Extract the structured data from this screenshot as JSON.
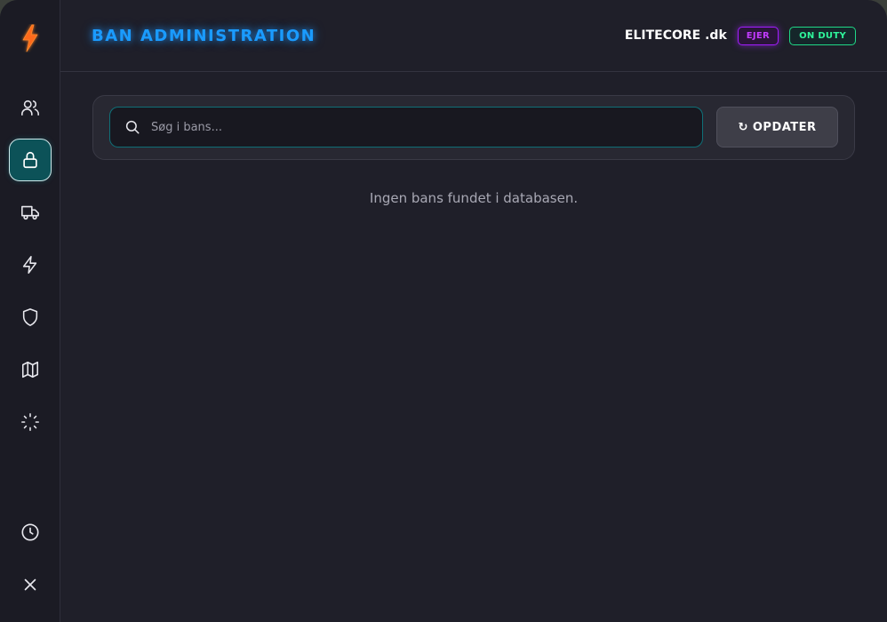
{
  "header": {
    "title": "BAN ADMINISTRATION",
    "server_name": "ELITECORE .dk",
    "badge_role": "EJER",
    "badge_status": "ON DUTY"
  },
  "sidebar": {
    "items": [
      {
        "icon": "users-icon"
      },
      {
        "icon": "lock-icon",
        "active": true
      },
      {
        "icon": "truck-icon"
      },
      {
        "icon": "bolt-icon"
      },
      {
        "icon": "shield-icon"
      },
      {
        "icon": "map-icon"
      },
      {
        "icon": "loader-icon"
      },
      {
        "icon": "clock-icon"
      },
      {
        "icon": "close-icon"
      }
    ]
  },
  "search": {
    "placeholder": "Søg i bans...",
    "value": ""
  },
  "toolbar": {
    "refresh_icon": "↻",
    "refresh_label": "OPDATER"
  },
  "content": {
    "empty_message": "Ingen bans fundet i databasen."
  },
  "colors": {
    "title_accent": "#1a9bff",
    "active_nav": "#0c5258",
    "badge_owner": "#a21cff",
    "badge_duty": "#1fd987"
  }
}
